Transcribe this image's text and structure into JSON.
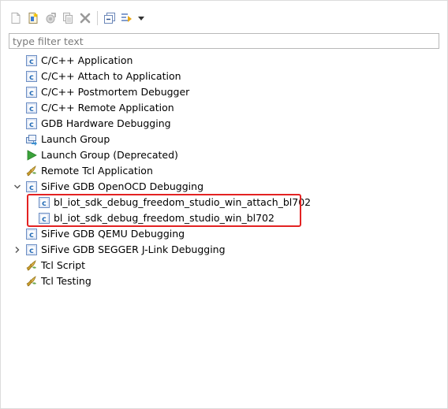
{
  "toolbar": {
    "buttons": [
      {
        "name": "new-configuration-icon"
      },
      {
        "name": "new-prototype-icon"
      },
      {
        "name": "export-icon"
      },
      {
        "name": "duplicate-icon"
      },
      {
        "name": "delete-icon"
      },
      {
        "name": "collapse-all-icon"
      },
      {
        "name": "filter-icon"
      },
      {
        "name": "view-menu-icon"
      }
    ]
  },
  "filter": {
    "placeholder": "type filter text",
    "value": ""
  },
  "tree": {
    "items": [
      {
        "label": "C/C++ Application",
        "icon": "c-config-icon",
        "level": 0,
        "expander": "none"
      },
      {
        "label": "C/C++ Attach to Application",
        "icon": "c-config-icon",
        "level": 0,
        "expander": "none"
      },
      {
        "label": "C/C++ Postmortem Debugger",
        "icon": "c-config-icon",
        "level": 0,
        "expander": "none"
      },
      {
        "label": "C/C++ Remote Application",
        "icon": "c-config-icon",
        "level": 0,
        "expander": "none"
      },
      {
        "label": "GDB Hardware Debugging",
        "icon": "c-config-icon",
        "level": 0,
        "expander": "none"
      },
      {
        "label": "Launch Group",
        "icon": "launch-group-icon",
        "level": 0,
        "expander": "none"
      },
      {
        "label": "Launch Group (Deprecated)",
        "icon": "run-arrow-icon",
        "level": 0,
        "expander": "none"
      },
      {
        "label": "Remote Tcl Application",
        "icon": "tcl-icon",
        "level": 0,
        "expander": "none"
      },
      {
        "label": "SiFive GDB OpenOCD Debugging",
        "icon": "c-config-icon",
        "level": 0,
        "expander": "expanded"
      },
      {
        "label": "bl_iot_sdk_debug_freedom_studio_win_attach_bl702",
        "icon": "c-config-icon",
        "level": 1,
        "expander": "none"
      },
      {
        "label": "bl_iot_sdk_debug_freedom_studio_win_bl702",
        "icon": "c-config-icon",
        "level": 1,
        "expander": "none"
      },
      {
        "label": "SiFive GDB QEMU Debugging",
        "icon": "c-config-icon",
        "level": 0,
        "expander": "none"
      },
      {
        "label": "SiFive GDB SEGGER J-Link Debugging",
        "icon": "c-config-icon",
        "level": 0,
        "expander": "collapsed"
      },
      {
        "label": "Tcl Script",
        "icon": "tcl-icon",
        "level": 0,
        "expander": "none"
      },
      {
        "label": "Tcl Testing",
        "icon": "tcl-icon",
        "level": 0,
        "expander": "none"
      }
    ]
  },
  "colors": {
    "highlight_border": "#e32222",
    "c_icon_blue": "#2a6fb8",
    "run_green": "#3aa33a"
  }
}
